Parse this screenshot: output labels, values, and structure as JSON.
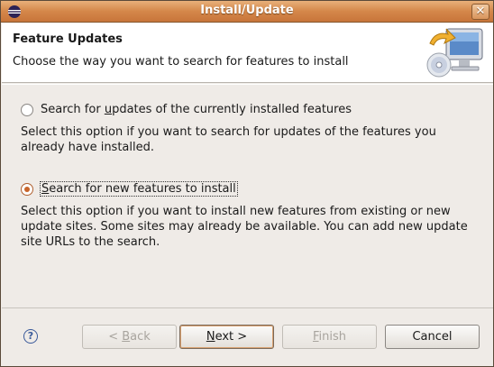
{
  "window": {
    "title": "Install/Update"
  },
  "banner": {
    "title": "Feature Updates",
    "description": "Choose the way you want to search for features to install"
  },
  "options": [
    {
      "label_pre": "Search for ",
      "label_mnemonic": "u",
      "label_post": "pdates of the currently installed features",
      "selected": false,
      "description_lines": [
        "Select this option if you want to search for updates of the features you",
        "already have installed."
      ]
    },
    {
      "label_pre": "",
      "label_mnemonic": "S",
      "label_post": "earch for new features to install",
      "selected": true,
      "description_lines": [
        "Select this option if you want to install new features from existing or new",
        "update sites. Some sites may already be available. You can add new update",
        "site URLs to the search."
      ]
    }
  ],
  "buttons": {
    "help": "?",
    "back_pre": "< ",
    "back_mnemonic": "B",
    "back_post": "ack",
    "next_mnemonic": "N",
    "next_post": "ext >",
    "finish_mnemonic": "F",
    "finish_post": "inish",
    "cancel": "Cancel"
  },
  "colors": {
    "titlebar": "#d4874a",
    "radio_selected": "#c8642a",
    "dialog_bg": "#efebe7"
  },
  "icons": {
    "app": "eclipse-icon",
    "banner": "computer-update-icon",
    "help": "help-icon",
    "close": "close-icon"
  }
}
